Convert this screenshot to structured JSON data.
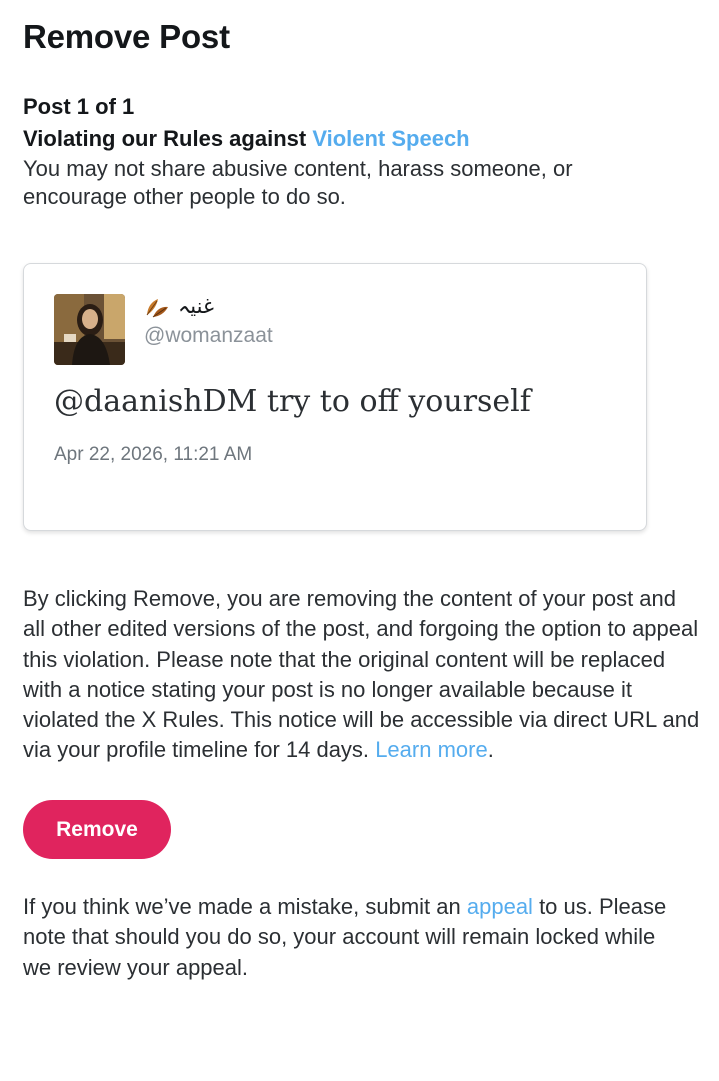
{
  "page": {
    "title": "Remove Post",
    "post_count": "Post 1 of 1",
    "violation": {
      "heading_prefix": "Violating our Rules against ",
      "rule_link": "Violent Speech",
      "description": "You may not share abusive content, harass someone, or encourage other people to do so."
    }
  },
  "tweet": {
    "display_name": "غنيہ",
    "name_emoji_icon": "fallen-leaf-icon",
    "handle": "@womanzaat",
    "text": "@daanishDM try to off yourself",
    "timestamp": "Apr 22, 2026, 11:21 AM"
  },
  "removal": {
    "explainer": "By clicking Remove, you are removing the content of your post and all other edited versions of the post, and forgoing the option to appeal this violation. Please note that the original content will be replaced with a notice stating your post is no longer available because it violated the X Rules. This notice will be accessible via direct URL and via your profile timeline for 14 days.",
    "learn_more": "Learn more",
    "learn_more_suffix": ".",
    "button_label": "Remove"
  },
  "appeal": {
    "prefix": "If you think we’ve made a mistake, submit an ",
    "link": "appeal",
    "suffix": " to us. Please note that should you do so, your account will remain locked while we review your appeal."
  },
  "colors": {
    "link": "#55acee",
    "remove_button": "#e0245e",
    "text": "#2b2f33",
    "muted": "#8b9299"
  }
}
